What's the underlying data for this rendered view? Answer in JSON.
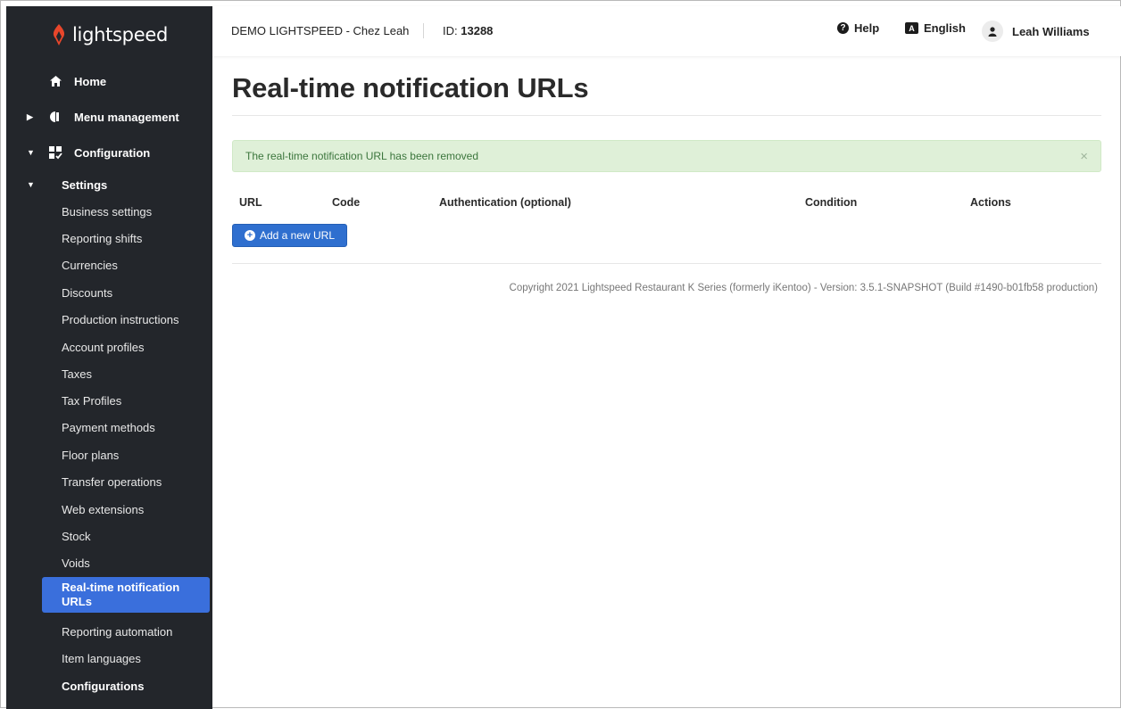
{
  "brand": {
    "name": "lightspeed",
    "accent": "#e8462b"
  },
  "sidebar": {
    "home": "Home",
    "menu_management": "Menu management",
    "configuration": "Configuration",
    "settings": "Settings",
    "items": [
      "Business settings",
      "Reporting shifts",
      "Currencies",
      "Discounts",
      "Production instructions",
      "Account profiles",
      "Taxes",
      "Tax Profiles",
      "Payment methods",
      "Floor plans",
      "Transfer operations",
      "Web extensions",
      "Stock",
      "Voids",
      "Real-time notification URLs",
      "Reporting automation",
      "Item languages"
    ],
    "active_item": "Real-time notification URLs",
    "configurations": "Configurations"
  },
  "header": {
    "account_name": "DEMO LIGHTSPEED - Chez Leah",
    "id_label": "ID:",
    "id_value": "13288",
    "help": "Help",
    "language": "English",
    "language_icon_letter": "A",
    "user_name": "Leah Williams"
  },
  "main": {
    "title": "Real-time notification URLs",
    "alert": "The real-time notification URL has been removed",
    "alert_close": "×",
    "columns": [
      "URL",
      "Code",
      "Authentication (optional)",
      "Condition",
      "Actions"
    ],
    "add_button": "Add a new URL"
  },
  "footer": "Copyright 2021 Lightspeed Restaurant K Series (formerly iKentoo) - Version: 3.5.1-SNAPSHOT (Build #1490-b01fb58 production)",
  "colors": {
    "sidebar_bg": "#23262b",
    "active_bg": "#3a6fdc",
    "alert_bg": "#dff0d8",
    "alert_text": "#3c763d",
    "button_bg": "#2f6fcf"
  }
}
